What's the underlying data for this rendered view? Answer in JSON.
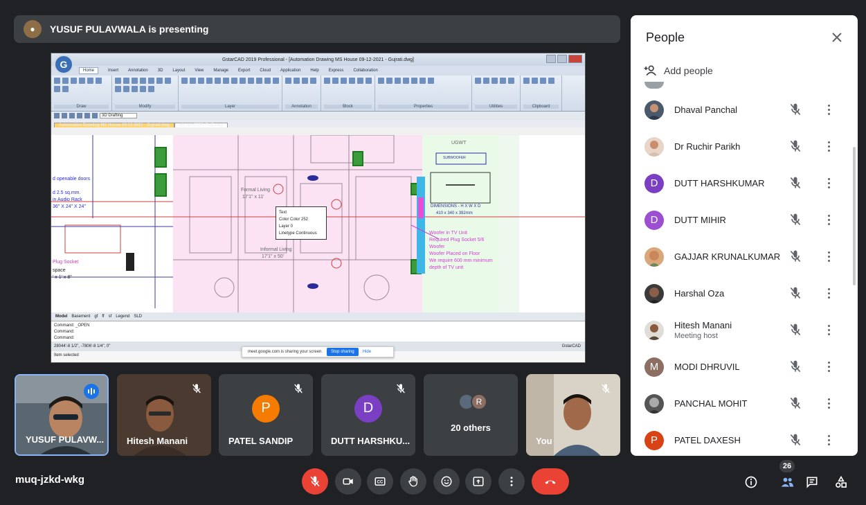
{
  "banner": {
    "text": "YUSUF PULAVWALA is presenting"
  },
  "cad": {
    "title": "GstarCAD 2019 Professional - [Automation Drawing MS House 09-12-2021 - Gujrati.dwg]",
    "menus": [
      "Home",
      "Insert",
      "Annotation",
      "3D",
      "Layout",
      "View",
      "Manage",
      "Export",
      "Cloud",
      "Application",
      "Help",
      "Express",
      "Collaboration"
    ],
    "ribbon_groups": [
      "Draw",
      "Modify",
      "Layer",
      "Annotation",
      "Block",
      "Properties",
      "Utilities",
      "Clipboard"
    ],
    "workspace": "3D Drafting",
    "tabs": [
      "Automation Drawing MS House 09-12-2021 - Gujrati.dwg",
      "MY MASTER FILE.dwg"
    ],
    "layouts": [
      "Model",
      "Basement",
      "gf",
      "ff",
      "sf",
      "Legend",
      "SLD"
    ],
    "commands": [
      "Command: _OPEN",
      "Command:",
      "Command:"
    ],
    "coords": "28044'-8 1/2\", -7806'-8 1/4\", 0\"",
    "footer": "Item selected",
    "brand": "GstarCAD",
    "share_text": "meet.google.com is sharing your screen.",
    "stop_label": "Stop sharing",
    "hide_label": "Hide",
    "tooltip": [
      "Text",
      "Color  Color 252",
      "Layer  0",
      "Linetype  Continuous"
    ],
    "labels": {
      "openable": "d openable doors",
      "sqmm": "d 2.5 sq.mm.",
      "audio_rack": "in Audio Rack",
      "dims1": "36\" X 24\" X 24\"",
      "formal": "Formal Living",
      "formal_dim": "17'1\" x 11'",
      "informal": "Informal Living",
      "informal_dim": "17'1\" x 50'",
      "plug": "Plug Socket",
      "space": "space",
      "space_dim": "' x 1' x 8\"",
      "ugwt": "UGWT",
      "subwoofer": "SUBWOOFER",
      "dimensions": "DIMENSIONS - H X W X D",
      "dim_vals": "410 x 340 x 392mm",
      "woofer1": "Woofer in TV Unit",
      "woofer2": "Required Plug Socket 5/6",
      "woofer3": "Woofer",
      "woofer4": "Woofer Placed on Floor",
      "woofer5": "We require 600 mm minimum",
      "woofer6": "depth of TV unit"
    }
  },
  "tiles": [
    {
      "name": "YUSUF PULAVW...",
      "active": true
    },
    {
      "name": "Hitesh Manani",
      "active": false
    },
    {
      "name": "PATEL SANDIP",
      "letter": "P",
      "color": "#f57c00"
    },
    {
      "name": "DUTT HARSHKU...",
      "letter": "D",
      "color": "#7b3fc4"
    },
    {
      "name": "20 others",
      "letter": "R",
      "color": "#8d6e63"
    },
    {
      "name": "You"
    }
  ],
  "people": {
    "title": "People",
    "add_label": "Add people",
    "list": [
      {
        "name": "Dhaval Panchal",
        "avatar": "photo",
        "color": "#4a5a6a"
      },
      {
        "name": "Dr Ruchir Parikh",
        "avatar": "photo",
        "color": "#c98d6b"
      },
      {
        "name": "DUTT HARSHKUMAR",
        "avatar": "D",
        "color": "#7b3fc4"
      },
      {
        "name": "DUTT MIHIR",
        "avatar": "D",
        "color": "#9c4fd0"
      },
      {
        "name": "GAJJAR KRUNALKUMAR",
        "avatar": "photo",
        "color": "#c9875a"
      },
      {
        "name": "Harshal Oza",
        "avatar": "photo",
        "color": "#3a3a3a"
      },
      {
        "name": "Hitesh Manani",
        "sub": "Meeting host",
        "avatar": "photo",
        "color": "#5a4a3a"
      },
      {
        "name": "MODI DHRUVIL",
        "avatar": "M",
        "color": "#8d6e63"
      },
      {
        "name": "PANCHAL MOHIT",
        "avatar": "photo",
        "color": "#555555"
      },
      {
        "name": "PATEL DAXESH",
        "avatar": "P",
        "color": "#d84315"
      }
    ]
  },
  "bottom": {
    "meeting_code": "muq-jzkd-wkg",
    "people_count": "26"
  },
  "colors": {
    "red": "#ea4335",
    "blue": "#1a73e8",
    "bg": "#202124",
    "tile": "#3c4043"
  }
}
